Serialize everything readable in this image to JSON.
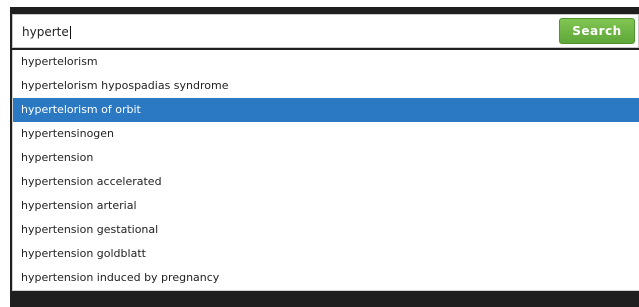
{
  "search": {
    "value": "hyperte",
    "button_label": "Search"
  },
  "suggestions": [
    "hypertelorism",
    "hypertelorism hypospadias syndrome",
    "hypertelorism of orbit",
    "hypertensinogen",
    "hypertension",
    "hypertension accelerated",
    "hypertension arterial",
    "hypertension gestational",
    "hypertension goldblatt",
    "hypertension induced by pregnancy"
  ],
  "selected_suggestion": "hypertelorism of orbit",
  "colors": {
    "frame": "#1f1f1f",
    "highlight": "#2b79c2",
    "button": "#6db443"
  }
}
